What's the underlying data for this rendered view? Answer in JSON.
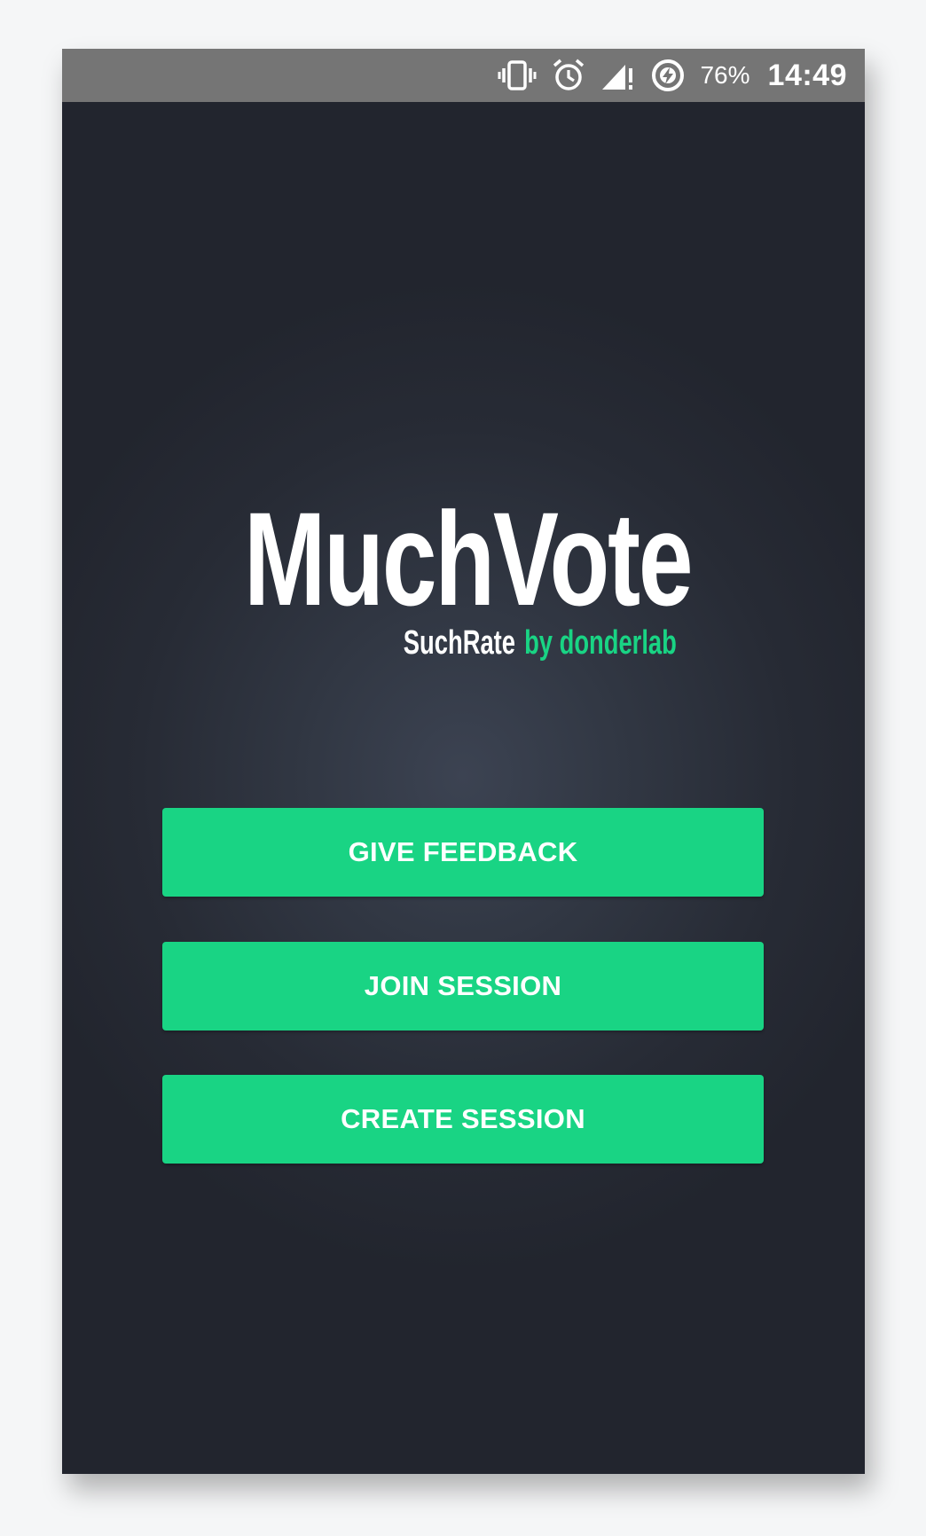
{
  "status_bar": {
    "icons": [
      "vibrate-icon",
      "alarm-icon",
      "signal-icon",
      "battery-charging-icon"
    ],
    "battery_percent": "76%",
    "time": "14:49",
    "background_color": "#757575"
  },
  "logo": {
    "title": "MuchVote",
    "tagline_brand": "SuchRate",
    "tagline_by": "by donderlab"
  },
  "actions": {
    "give_feedback": "GIVE FEEDBACK",
    "join_session": "JOIN SESSION",
    "create_session": "CREATE SESSION"
  },
  "colors": {
    "accent": "#19d484",
    "background": "#23262f",
    "text": "#ffffff"
  }
}
